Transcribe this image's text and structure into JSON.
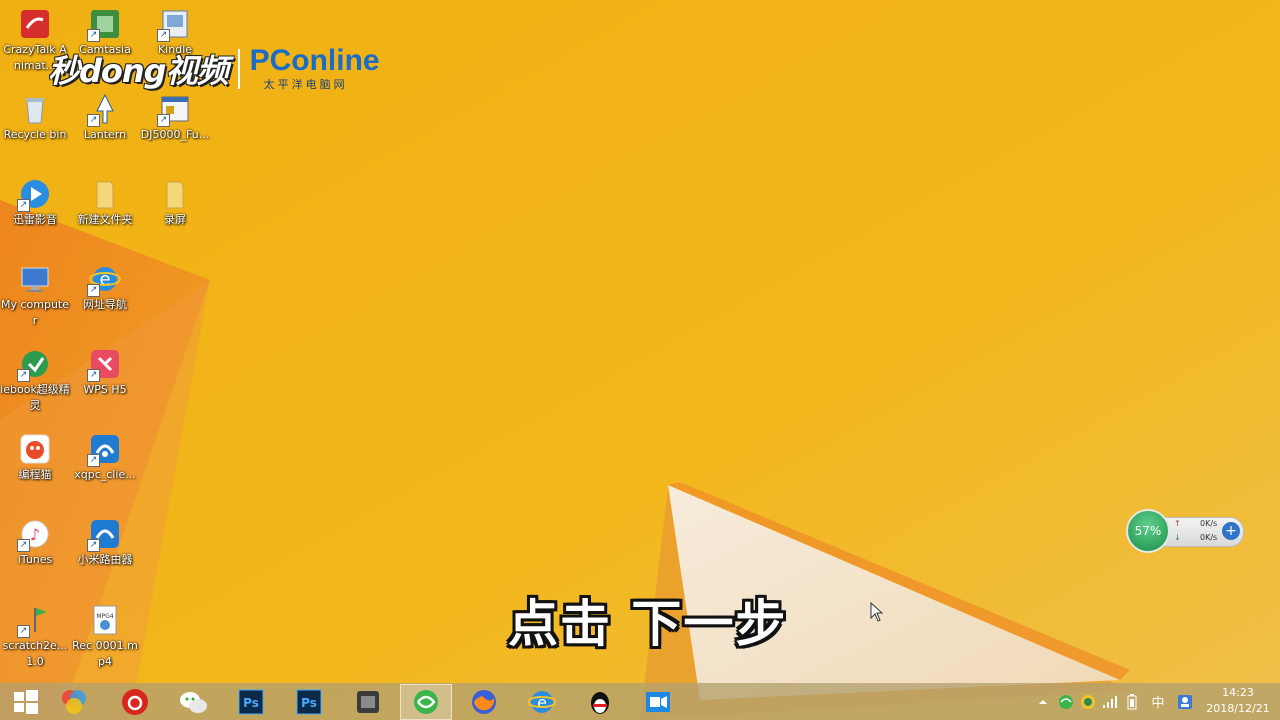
{
  "desktop_icons": [
    {
      "label": "CrazyTalk Animat..."
    },
    {
      "label": "Camtasia"
    },
    {
      "label": "Kindle"
    },
    {
      "label": "Recycle bin"
    },
    {
      "label": "Lantern"
    },
    {
      "label": "DJ5000_Fu..."
    },
    {
      "label": "迅雷影音"
    },
    {
      "label": "新建文件夹"
    },
    {
      "label": "录屏"
    },
    {
      "label": "My computer"
    },
    {
      "label": "网址导航"
    },
    {
      "label": "iebook超级精灵"
    },
    {
      "label": "WPS H5"
    },
    {
      "label": "编程猫"
    },
    {
      "label": "xqpc_clie..."
    },
    {
      "label": "iTunes"
    },
    {
      "label": "小米路由器"
    },
    {
      "label": "scratch2e... 1.0"
    },
    {
      "label": "Rec 0001.mp4"
    }
  ],
  "watermark": {
    "brand_cn": "秒dong视频",
    "brand_en": "PConline",
    "brand_en_sub": "太平洋电脑网"
  },
  "subtitle": "点击 下一步",
  "net_widget": {
    "percent": "57%",
    "upload": "0K/s",
    "download": "0K/s"
  },
  "taskbar": {
    "apps": [
      "start",
      "colorful-app",
      "netease-music",
      "wechat",
      "photoshop-1",
      "photoshop-2",
      "video-app",
      "browser-360",
      "firefox",
      "internet-explorer",
      "qq",
      "screen-recorder"
    ],
    "active_app": "browser-360",
    "tray": {
      "ime": "中",
      "time": "14:23",
      "date": "2018/12/21"
    }
  },
  "colors": {
    "wallpaper": "#f1b417",
    "taskbar": "#b4a06e",
    "watermark_blue": "#1a6cc4"
  }
}
